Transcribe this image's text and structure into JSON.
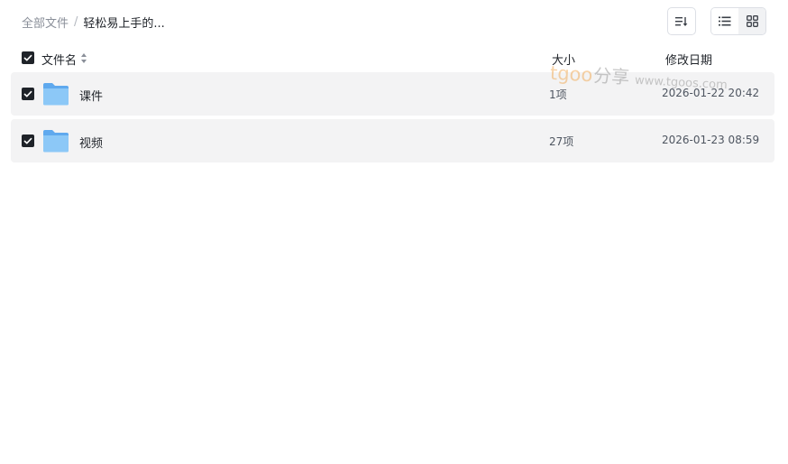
{
  "breadcrumb": {
    "root": "全部文件",
    "separator": "/",
    "current": "轻松易上手的..."
  },
  "toolbar": {
    "sort_icon": "sort-icon",
    "list_view_icon": "list-view-icon",
    "grid_view_icon": "grid-view-icon",
    "active_view": "list"
  },
  "table": {
    "columns": {
      "name": "文件名",
      "size": "大小",
      "modified": "修改日期"
    },
    "header_checked": true,
    "rows": [
      {
        "name": "课件",
        "size": "1项",
        "modified": "2026-01-22 20:42",
        "checked": true,
        "icon": "folder-icon"
      },
      {
        "name": "视频",
        "size": "27项",
        "modified": "2026-01-23 08:59",
        "checked": true,
        "icon": "folder-icon"
      }
    ]
  },
  "watermark": {
    "brand": "tgoo",
    "cn": "分享",
    "url": "www.tgoos.com"
  },
  "colors": {
    "row_background": "#f3f3f4",
    "checkbox": "#1f2329",
    "folder": "#7fbff5",
    "watermark_brand": "#f0a040"
  }
}
